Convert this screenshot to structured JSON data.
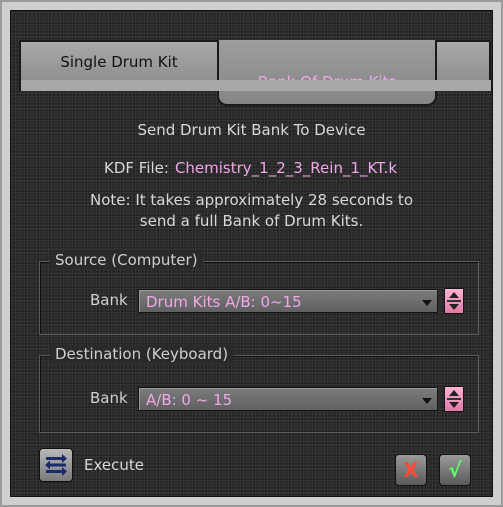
{
  "tabs": [
    {
      "label": "Single Drum Kit",
      "active": false
    },
    {
      "label": "Bank Of Drum Kits",
      "active": true
    }
  ],
  "heading": "Send Drum Kit Bank To Device",
  "kdf": {
    "label": "KDF File:",
    "value": "Chemistry_1_2_3_Rein_1_KT.k"
  },
  "note_line1": "Note: It takes approximately 28 seconds to",
  "note_line2": "send a full Bank of Drum Kits.",
  "source": {
    "title": "Source (Computer)",
    "field_label": "Bank",
    "selected": "Drum Kits A/B: 0~15"
  },
  "destination": {
    "title": "Destination (Keyboard)",
    "field_label": "Bank",
    "selected": "A/B: 0 ~ 15"
  },
  "execute_label": "Execute",
  "icons": {
    "execute": "execute-icon",
    "cancel": "x-icon",
    "ok": "checkmark-icon",
    "cancel_glyph": "X",
    "ok_glyph": "√"
  },
  "colors": {
    "accent_text": "#f0a8e8",
    "panel_bg": "#2a2a2a",
    "cancel": "#ff4a3a",
    "ok": "#5cff6a"
  }
}
